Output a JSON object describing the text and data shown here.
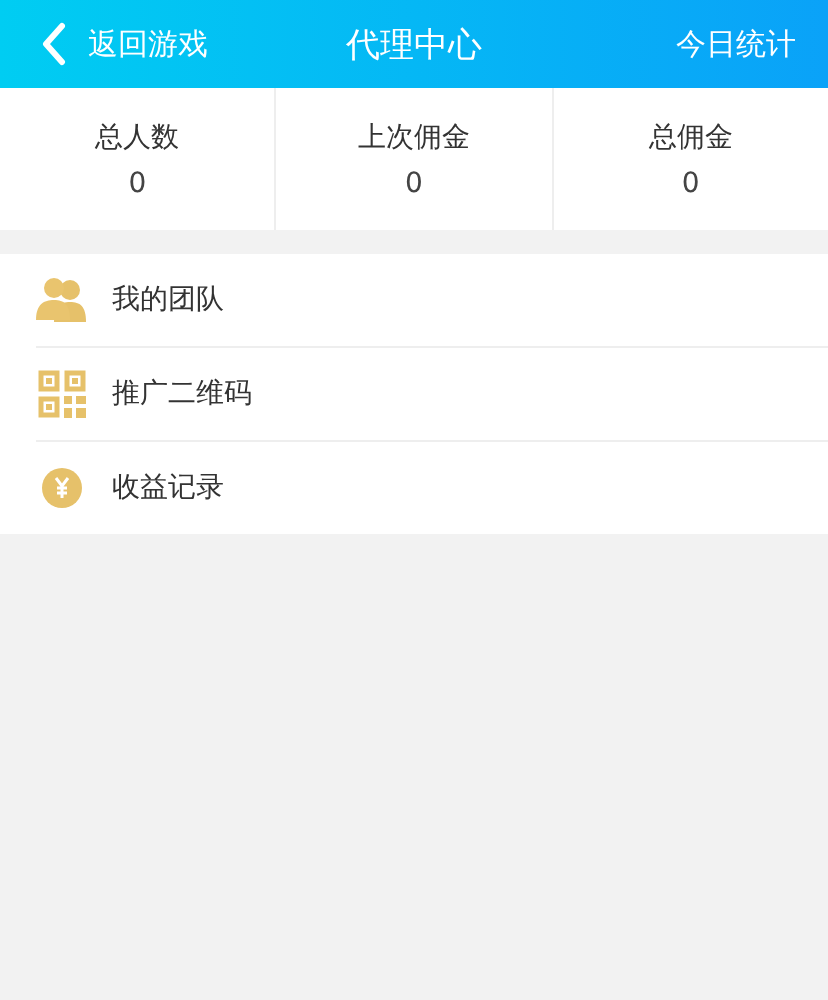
{
  "header": {
    "back": "返回游戏",
    "title": "代理中心",
    "action": "今日统计"
  },
  "stats": [
    {
      "label": "总人数",
      "value": "0"
    },
    {
      "label": "上次佣金",
      "value": "0"
    },
    {
      "label": "总佣金",
      "value": "0"
    }
  ],
  "menu": [
    {
      "kind": "team",
      "label": "我的团队"
    },
    {
      "kind": "qr",
      "label": "推广二维码"
    },
    {
      "kind": "coin",
      "label": "收益记录"
    }
  ]
}
